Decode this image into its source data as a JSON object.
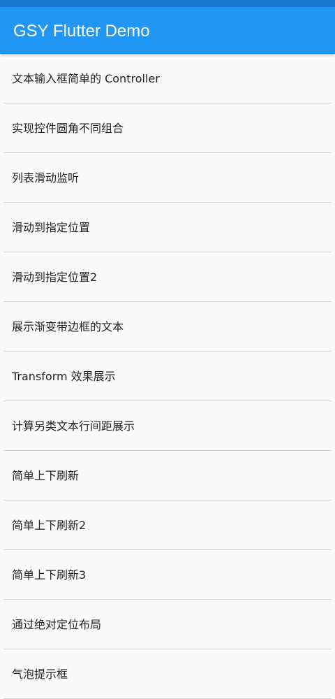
{
  "app_bar": {
    "title": "GSY Flutter Demo",
    "color": "#2196f3"
  },
  "status_bar": {
    "color": "#1976d2"
  },
  "list": {
    "items": [
      {
        "label": "文本输入框简单的 Controller"
      },
      {
        "label": "实现控件圆角不同组合"
      },
      {
        "label": "列表滑动监听"
      },
      {
        "label": "滑动到指定位置"
      },
      {
        "label": "滑动到指定位置2"
      },
      {
        "label": "展示渐变带边框的文本"
      },
      {
        "label": "Transform 效果展示"
      },
      {
        "label": "计算另类文本行间距展示"
      },
      {
        "label": "简单上下刷新"
      },
      {
        "label": "简单上下刷新2"
      },
      {
        "label": "简单上下刷新3"
      },
      {
        "label": "通过绝对定位布局"
      },
      {
        "label": "气泡提示框"
      }
    ]
  }
}
